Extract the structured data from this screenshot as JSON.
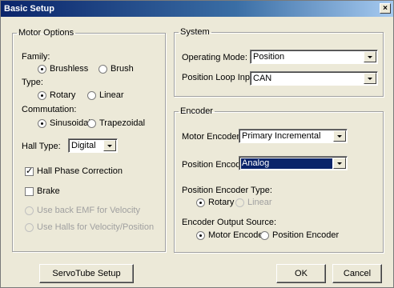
{
  "window": {
    "title": "Basic Setup",
    "close_glyph": "×"
  },
  "motor_options": {
    "legend": "Motor Options",
    "family": {
      "label": "Family:",
      "options": [
        "Brushless",
        "Brush"
      ],
      "selected": "Brushless"
    },
    "type": {
      "label": "Type:",
      "options": [
        "Rotary",
        "Linear"
      ],
      "selected": "Rotary"
    },
    "commutation": {
      "label": "Commutation:",
      "options": [
        "Sinusoidal",
        "Trapezoidal"
      ],
      "selected": "Sinusoidal"
    },
    "hall_type": {
      "label": "Hall Type:",
      "value": "Digital"
    },
    "hall_phase_correction": {
      "label": "Hall Phase Correction",
      "checked": true
    },
    "brake": {
      "label": "Brake",
      "checked": false
    },
    "use_back_emf": {
      "label": "Use back EMF for Velocity",
      "enabled": false
    },
    "use_halls": {
      "label": "Use Halls for Velocity/Position",
      "enabled": false
    }
  },
  "system": {
    "legend": "System",
    "operating_mode": {
      "label": "Operating Mode:",
      "value": "Position"
    },
    "position_loop_input": {
      "label": "Position Loop Input:",
      "value": "CAN"
    }
  },
  "encoder": {
    "legend": "Encoder",
    "motor_encoder": {
      "label": "Motor Encoder:",
      "value": "Primary Incremental"
    },
    "position_encoder": {
      "label": "Position Encoder:",
      "value": "Analog"
    },
    "position_encoder_type": {
      "label": "Position Encoder Type:",
      "options": [
        "Rotary",
        "Linear"
      ],
      "selected": "Rotary"
    },
    "output_source": {
      "label": "Encoder Output Source:",
      "options": [
        "Motor Encoder",
        "Position Encoder"
      ],
      "selected": "Motor Encoder"
    }
  },
  "buttons": {
    "servotube_setup": "ServoTube Setup",
    "ok": "OK",
    "cancel": "Cancel"
  },
  "colors": {
    "dialog_bg": "#ece9d8",
    "title_bar": "#0a246a",
    "selection": "#0a246a"
  }
}
